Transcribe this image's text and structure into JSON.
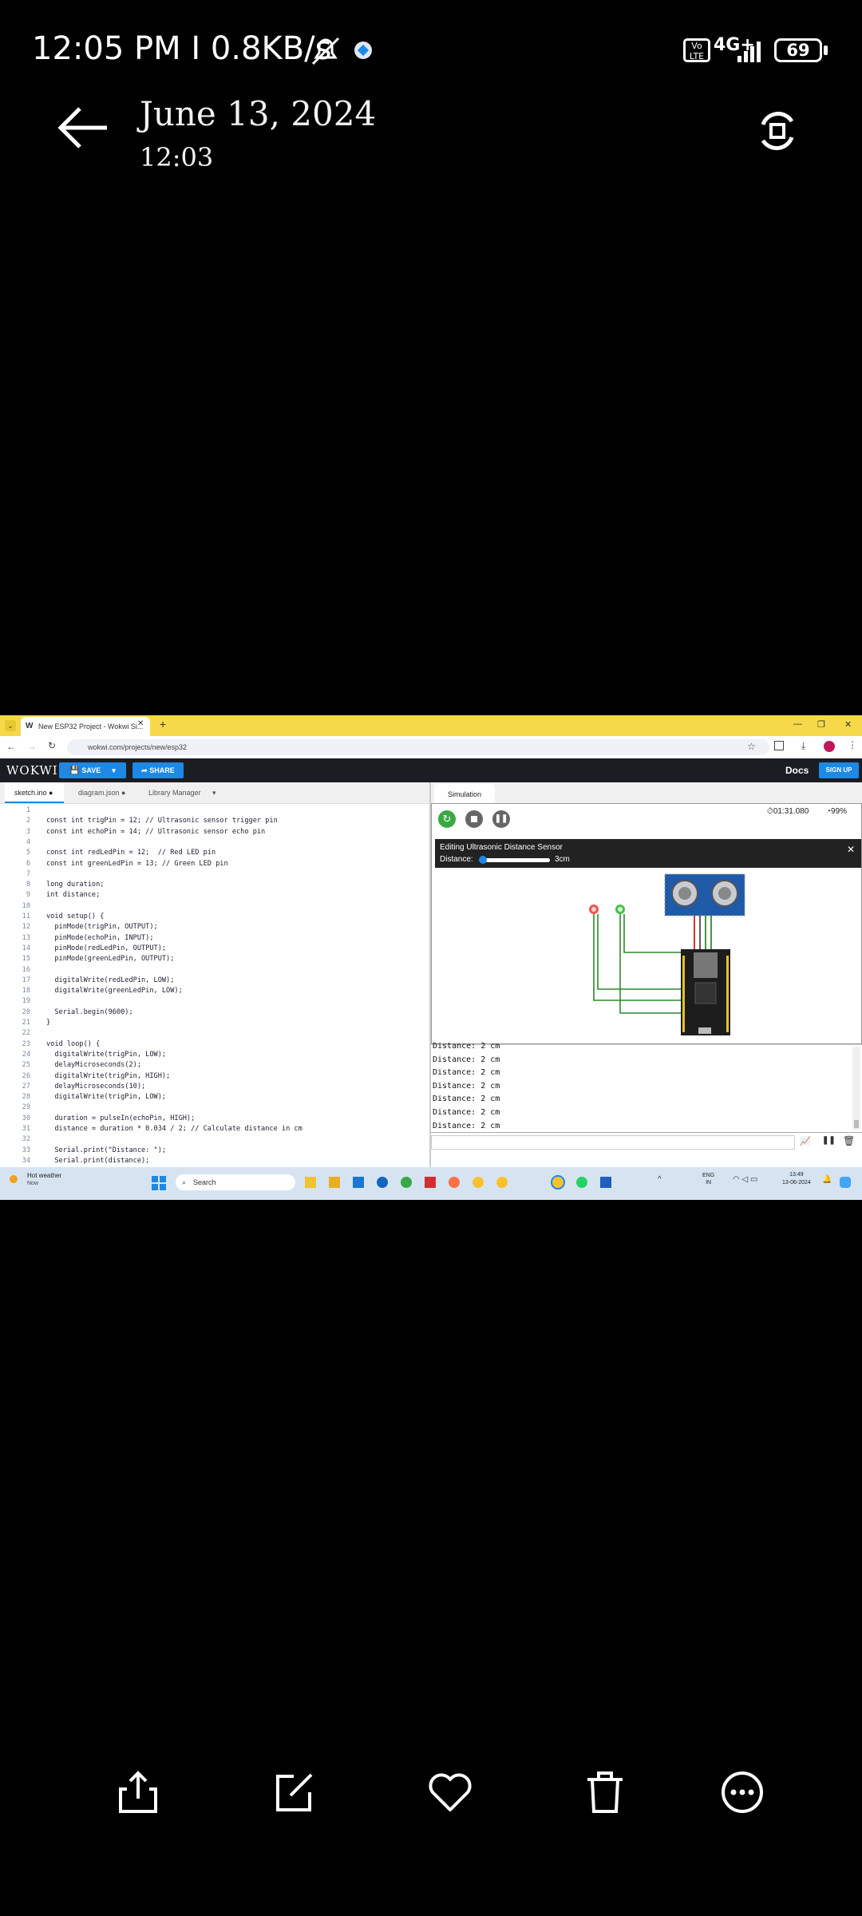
{
  "status_bar": {
    "time": "12:05 PM",
    "separator": "I",
    "net_speed": "0.8KB/s",
    "network": "4G+",
    "battery": "69"
  },
  "header": {
    "date": "June 13, 2024",
    "time": "12:03"
  },
  "browser": {
    "tab_title": "New ESP32 Project - Wokwi Si...",
    "url": "wokwi.com/projects/new/esp32"
  },
  "wokwi": {
    "logo": "WOKWI",
    "save": "SAVE",
    "share": "SHARE",
    "docs": "Docs",
    "signup": "SIGN UP"
  },
  "editor": {
    "tabs": [
      "sketch.ino",
      "diagram.json",
      "Library Manager"
    ],
    "lines": [
      {
        "n": "1",
        "t": ""
      },
      {
        "n": "2",
        "t": "const int trigPin = 12; // Ultrasonic sensor trigger pin"
      },
      {
        "n": "3",
        "t": "const int echoPin = 14; // Ultrasonic sensor echo pin"
      },
      {
        "n": "4",
        "t": ""
      },
      {
        "n": "5",
        "t": "const int redLedPin = 12;  // Red LED pin"
      },
      {
        "n": "6",
        "t": "const int greenLedPin = 13; // Green LED pin"
      },
      {
        "n": "7",
        "t": ""
      },
      {
        "n": "8",
        "t": "long duration;"
      },
      {
        "n": "9",
        "t": "int distance;"
      },
      {
        "n": "10",
        "t": ""
      },
      {
        "n": "11",
        "t": "void setup() {"
      },
      {
        "n": "12",
        "t": "  pinMode(trigPin, OUTPUT);"
      },
      {
        "n": "13",
        "t": "  pinMode(echoPin, INPUT);"
      },
      {
        "n": "14",
        "t": "  pinMode(redLedPin, OUTPUT);"
      },
      {
        "n": "15",
        "t": "  pinMode(greenLedPin, OUTPUT);"
      },
      {
        "n": "16",
        "t": ""
      },
      {
        "n": "17",
        "t": "  digitalWrite(redLedPin, LOW);"
      },
      {
        "n": "18",
        "t": "  digitalWrite(greenLedPin, LOW);"
      },
      {
        "n": "19",
        "t": ""
      },
      {
        "n": "20",
        "t": "  Serial.begin(9600);"
      },
      {
        "n": "21",
        "t": "}"
      },
      {
        "n": "22",
        "t": ""
      },
      {
        "n": "23",
        "t": "void loop() {"
      },
      {
        "n": "24",
        "t": "  digitalWrite(trigPin, LOW);"
      },
      {
        "n": "25",
        "t": "  delayMicroseconds(2);"
      },
      {
        "n": "26",
        "t": "  digitalWrite(trigPin, HIGH);"
      },
      {
        "n": "27",
        "t": "  delayMicroseconds(10);"
      },
      {
        "n": "28",
        "t": "  digitalWrite(trigPin, LOW);"
      },
      {
        "n": "29",
        "t": ""
      },
      {
        "n": "30",
        "t": "  duration = pulseIn(echoPin, HIGH);"
      },
      {
        "n": "31",
        "t": "  distance = duration * 0.034 / 2; // Calculate distance in cm"
      },
      {
        "n": "32",
        "t": ""
      },
      {
        "n": "33",
        "t": "  Serial.print(\"Distance: \");"
      },
      {
        "n": "34",
        "t": "  Serial.print(distance);"
      }
    ]
  },
  "simulation": {
    "tab": "Simulation",
    "timer": "01:31.080",
    "speed": "99%",
    "panel_title": "Editing Ultrasonic Distance Sensor",
    "distance_label": "Distance:",
    "distance_value": "3cm",
    "distance_fraction": 0.01,
    "serial_lines": [
      "Distance: 2 cm",
      "Distance: 2 cm",
      "Distance: 2 cm",
      "Distance: 2 cm",
      "Distance: 2 cm",
      "Distance: 2 cm",
      "Distance: 2 cm"
    ]
  },
  "taskbar": {
    "weather_title": "Hot weather",
    "weather_sub": "Now",
    "search": "Search",
    "lang": "ENG",
    "region": "IN",
    "clock": "13:49",
    "date": "13-06-2024"
  }
}
